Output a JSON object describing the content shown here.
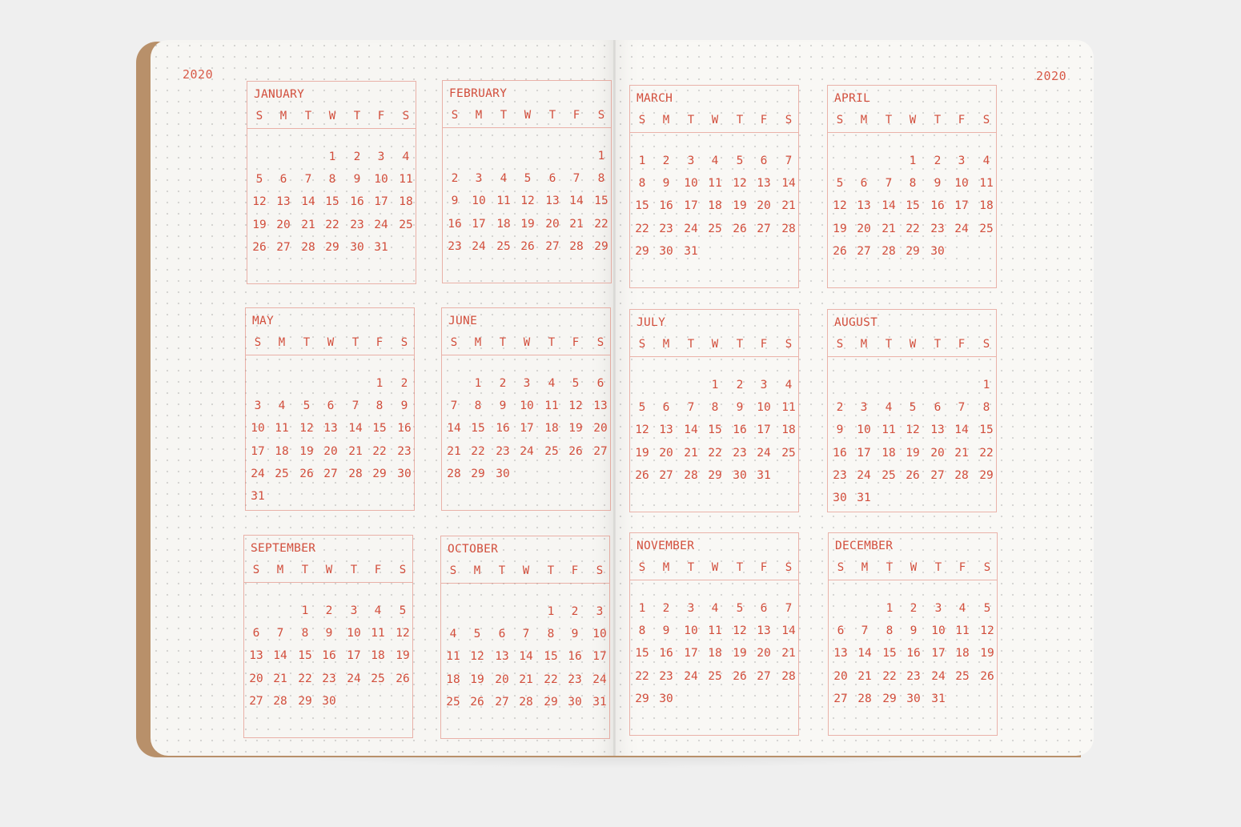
{
  "year_left": "2020",
  "year_right": "2020",
  "weekday_labels": [
    "S",
    "M",
    "T",
    "W",
    "T",
    "F",
    "S"
  ],
  "months": [
    {
      "name": "JANUARY",
      "offset": 3,
      "days": 31
    },
    {
      "name": "FEBRUARY",
      "offset": 6,
      "days": 29
    },
    {
      "name": "MARCH",
      "offset": 0,
      "days": 31
    },
    {
      "name": "APRIL",
      "offset": 3,
      "days": 30
    },
    {
      "name": "MAY",
      "offset": 5,
      "days": 31
    },
    {
      "name": "JUNE",
      "offset": 1,
      "days": 30
    },
    {
      "name": "JULY",
      "offset": 3,
      "days": 31
    },
    {
      "name": "AUGUST",
      "offset": 6,
      "days": 31
    },
    {
      "name": "SEPTEMBER",
      "offset": 2,
      "days": 30
    },
    {
      "name": "OCTOBER",
      "offset": 4,
      "days": 31
    },
    {
      "name": "NOVEMBER",
      "offset": 0,
      "days": 30
    },
    {
      "name": "DECEMBER",
      "offset": 2,
      "days": 31
    }
  ],
  "colors": {
    "accent": "#d24e3c",
    "cover": "#b8906a",
    "paper": "#f7f6f3"
  }
}
